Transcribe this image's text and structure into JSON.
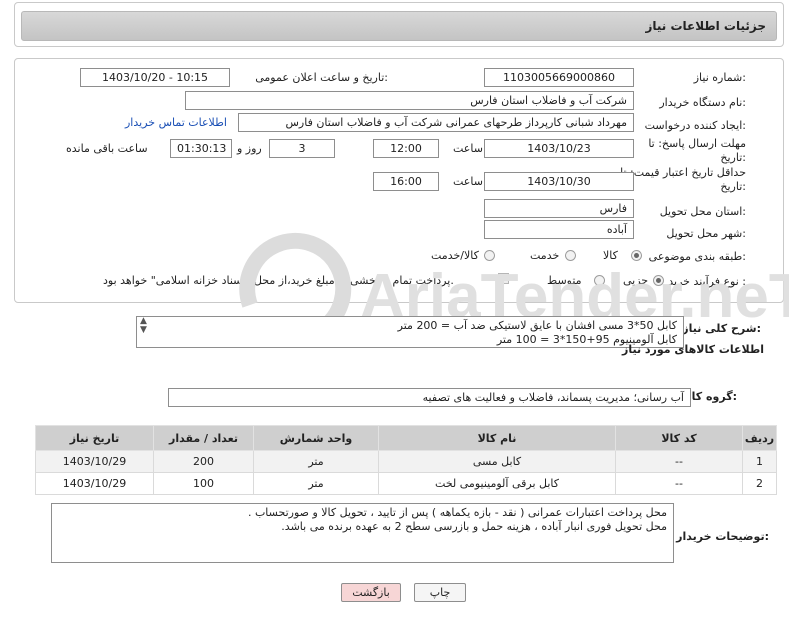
{
  "header": {
    "title": "جزئیات اطلاعات نیاز"
  },
  "form": {
    "need_number_label": "شماره نیاز:",
    "need_number": "1103005669000860",
    "announce_label": "تاریخ و ساعت اعلان عمومی:",
    "announce_value": "1403/10/20 - 10:15",
    "buyer_org_label": "نام دستگاه خریدار:",
    "buyer_org": "شرکت آب و فاضلاب استان فارس",
    "requester_label": "ایجاد کننده درخواست:",
    "requester": "مهرداد شبانی کارپرداز طرحهای عمرانی  شرکت آب و فاضلاب استان فارس",
    "contact_link": "اطلاعات تماس خریدار",
    "deadline_label_1": "مهلت ارسال پاسخ: تا",
    "deadline_label_2": "تاریخ:",
    "deadline_date": "1403/10/23",
    "time_label": "ساعت",
    "deadline_time": "12:00",
    "days_value": "3",
    "days_label": "روز و",
    "remaining_time": "01:30:13",
    "remaining_label": "ساعت باقی مانده",
    "min_validity_label_1": "حداقل تاریخ اعتبار قیمت: تا",
    "min_validity_label_2": "تاریخ:",
    "validity_date": "1403/10/30",
    "validity_time_label": "ساعت",
    "validity_time": "16:00",
    "province_label": "استان محل تحویل:",
    "province": "فارس",
    "city_label": "شهر محل تحویل:",
    "city": "آباده",
    "category_label": "طبقه بندی موضوعی:",
    "category_options": [
      "کالا",
      "خدمت",
      "کالا/خدمت"
    ],
    "category_selected": "کالا",
    "process_label": "نوع فرآیند خرید :",
    "process_options": [
      "جزیی",
      "متوسط"
    ],
    "process_selected": "جزیی",
    "payment_note": "پرداخت تمام یا بخشی از مبلغ خرید،از محل \"اسناد خزانه اسلامی\" خواهد بود."
  },
  "description": {
    "label": "شرح کلی نیاز:",
    "lines": [
      "کابل 50*3 مسی افشان با عایق لاستیکی ضد آب = 200 متر",
      "کابل آلومینیوم 95+150*3 = 100 متر"
    ]
  },
  "goods_section": {
    "title": "اطلاعات کالاهای مورد نیاز",
    "group_label": "گروه کالا:",
    "group_value": "آب رسانی؛ مدیریت پسماند، فاضلاب و فعالیت های تصفیه"
  },
  "table": {
    "headers": [
      "ردیف",
      "کد کالا",
      "نام کالا",
      "واحد شمارش",
      "تعداد / مقدار",
      "تاریخ نیاز"
    ],
    "rows": [
      [
        "1",
        "--",
        "کابل مسی",
        "متر",
        "200",
        "1403/10/29"
      ],
      [
        "2",
        "--",
        "کابل برقی آلومینیومی لخت",
        "متر",
        "100",
        "1403/10/29"
      ]
    ]
  },
  "buyer_notes": {
    "label": "توضیحات خریدار:",
    "lines": [
      "محل پرداخت اعتبارات عمرانی ( نقد - بازه یکماهه ) پس از تایید ، تحویل کالا و صورتحساب .",
      "محل تحویل فوری انبار آباده ، هزینه حمل و بازرسی سطح 2 به عهده برنده می باشد."
    ]
  },
  "buttons": {
    "print": "چاپ",
    "back": "بازگشت"
  },
  "watermark": "AriaTender.neT",
  "colors": {
    "header_bg": "#cfcfcf",
    "link": "#1a4fb5",
    "back_btn_bg": "#f7d6d6",
    "watermark": "#d9d9d9"
  }
}
